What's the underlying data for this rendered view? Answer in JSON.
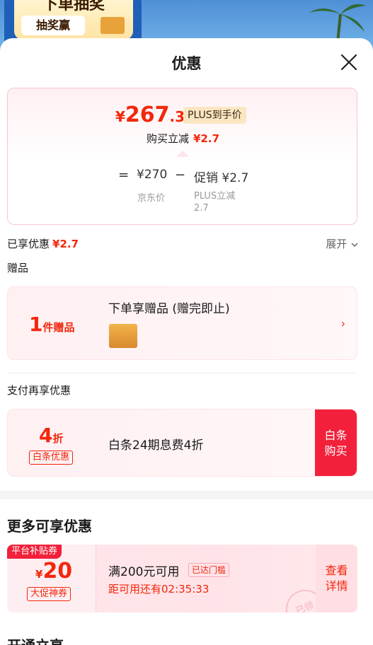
{
  "background": {
    "promo_title": "下单抽奖",
    "promo_sub": "抽奖赢"
  },
  "sheet": {
    "title": "优惠"
  },
  "price_box": {
    "currency": "¥",
    "final_int": "267",
    "final_dec": ".3",
    "plus_tag": "PLUS到手价",
    "buy_reduce_label": "购买立减",
    "buy_reduce_amount": "¥2.7",
    "calc_equals": "=",
    "calc_jd_price": "¥270",
    "calc_minus": "−",
    "calc_promo": "促销 ¥2.7",
    "calc_jd_label": "京东价",
    "calc_plus_label": "PLUS立减 2.7"
  },
  "enjoyed": {
    "label": "已享优惠",
    "amount": "¥2.7",
    "expand_label": "展开"
  },
  "gift": {
    "section_title": "赠品",
    "count_num": "1",
    "count_unit": "件赠品",
    "desc": "下单享赠品 (赠完即止)"
  },
  "pay": {
    "section_title": "支付再享优惠",
    "discount_num": "4",
    "discount_unit": "折",
    "tag": "白条优惠",
    "desc": "白条24期息费4折",
    "button_line1": "白条",
    "button_line2": "购买"
  },
  "more": {
    "title": "更多可享优惠",
    "coupon": {
      "badge": "平台补贴券",
      "currency": "¥",
      "value": "20",
      "type": "大促神券",
      "condition": "满200元可用",
      "threshold": "已达门槛",
      "countdown": "距可用还有02:35:33",
      "button_line1": "查看",
      "button_line2": "详情",
      "stamp": "已领"
    }
  },
  "bottom": {
    "title_partial": "开通立享"
  },
  "colors": {
    "accent_red": "#f2270c",
    "button_red": "#f2203a",
    "plus_gold": "#fbe6c2"
  }
}
